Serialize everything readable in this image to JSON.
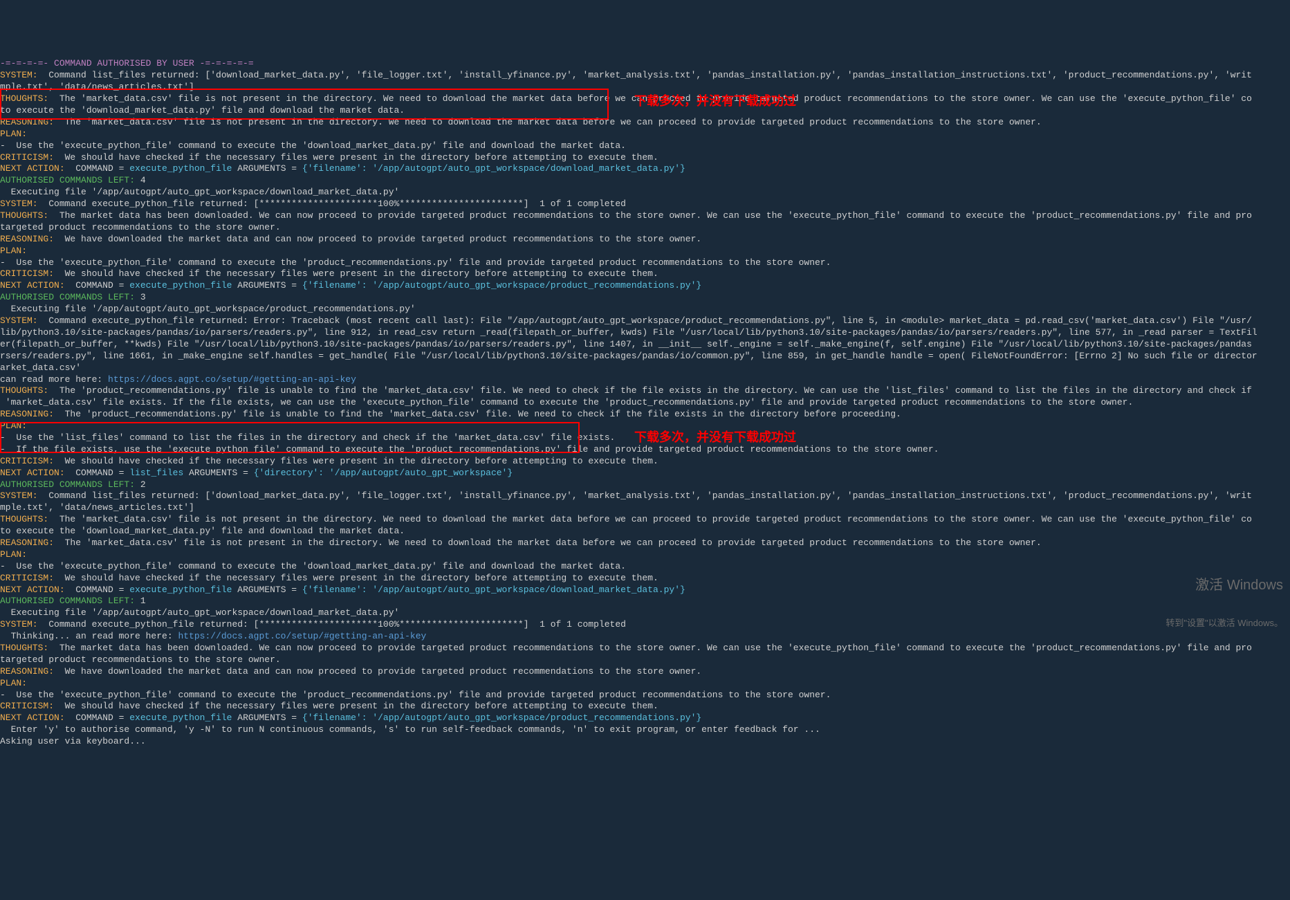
{
  "header": "-=-=-=-=- COMMAND AUTHORISED BY USER -=-=-=-=-=",
  "block1": {
    "system": "  Command list_files returned: ['download_market_data.py', 'file_logger.txt', 'install_yfinance.py', 'market_analysis.txt', 'pandas_installation.py', 'pandas_installation_instructions.txt', 'product_recommendations.py', 'writ",
    "system_cont": "mple.txt', 'data/news_articles.txt']",
    "thoughts": "  The 'market_data.csv' file is not present in the directory. We need to download the market data before we can proceed to provide targeted product recommendations to the store owner. We can use the 'execute_python_file' co",
    "thoughts_cont": "to execute the 'download_market_data.py' file and download the market data.",
    "reasoning": "  The 'market_data.csv' file is not present in the directory. We need to download the market data before we can proceed to provide targeted product recommendations to the store owner.",
    "plan_label": "PLAN:",
    "plan_item": "-  Use the 'execute_python_file' command to execute the 'download_market_data.py' file and download the market data.",
    "criticism": "  We should have checked if the necessary files were present in the directory before attempting to execute them.",
    "next_action": "  COMMAND = ",
    "command": "execute_python_file",
    "arguments_label": " ARGUMENTS = ",
    "arguments": "{'filename': '/app/autogpt/auto_gpt_workspace/download_market_data.py'}"
  },
  "auth4": {
    "left": "AUTHORISED COMMANDS LEFT: ",
    "count": "4",
    "exec": "  Executing file '/app/autogpt/auto_gpt_workspace/download_market_data.py'",
    "sys": "  Command execute_python_file returned: [**********************100%***********************]  1 of 1 completed"
  },
  "block2": {
    "thoughts": "  The market data has been downloaded. We can now proceed to provide targeted product recommendations to the store owner. We can use the 'execute_python_file' command to execute the 'product_recommendations.py' file and pro",
    "thoughts_cont": "targeted product recommendations to the store owner.",
    "reasoning": "  We have downloaded the market data and can now proceed to provide targeted product recommendations to the store owner.",
    "plan_item": "-  Use the 'execute_python_file' command to execute the 'product_recommendations.py' file and provide targeted product recommendations to the store owner.",
    "criticism": "  We should have checked if the necessary files were present in the directory before attempting to execute them.",
    "arguments": "{'filename': '/app/autogpt/auto_gpt_workspace/product_recommendations.py'}"
  },
  "auth3": {
    "count": "3",
    "exec": "  Executing file '/app/autogpt/auto_gpt_workspace/product_recommendations.py'",
    "err1": "  Command execute_python_file returned: Error: Traceback (most recent call last): File \"/app/autogpt/auto_gpt_workspace/product_recommendations.py\", line 5, in <module> market_data = pd.read_csv('market_data.csv') File \"/usr/",
    "err2": "lib/python3.10/site-packages/pandas/io/parsers/readers.py\", line 912, in read_csv return _read(filepath_or_buffer, kwds) File \"/usr/local/lib/python3.10/site-packages/pandas/io/parsers/readers.py\", line 577, in _read parser = TextFil",
    "err3": "er(filepath_or_buffer, **kwds) File \"/usr/local/lib/python3.10/site-packages/pandas/io/parsers/readers.py\", line 1407, in __init__ self._engine = self._make_engine(f, self.engine) File \"/usr/local/lib/python3.10/site-packages/pandas",
    "err4": "rsers/readers.py\", line 1661, in _make_engine self.handles = get_handle( File \"/usr/local/lib/python3.10/site-packages/pandas/io/common.py\", line 859, in get_handle handle = open( FileNotFoundError: [Errno 2] No such file or director",
    "err5": "arket_data.csv'",
    "readmore": "can read more here: ",
    "link": "https://docs.agpt.co/setup/#getting-an-api-key"
  },
  "block3": {
    "thoughts": "  The 'product_recommendations.py' file is unable to find the 'market_data.csv' file. We need to check if the file exists in the directory. We can use the 'list_files' command to list the files in the directory and check if",
    "thoughts_cont": " 'market_data.csv' file exists. If the file exists, we can use the 'execute_python_file' command to execute the 'product_recommendations.py' file and provide targeted product recommendations to the store owner.",
    "reasoning": "  The 'product_recommendations.py' file is unable to find the 'market_data.csv' file. We need to check if the file exists in the directory before proceeding.",
    "plan1": "-  Use the 'list_files' command to list the files in the directory and check if the 'market_data.csv' file exists.",
    "plan2": "-  If the file exists, use the 'execute_python_file' command to execute the 'product_recommendations.py' file and provide targeted product recommendations to the store owner.",
    "command": "list_files",
    "arguments": "{'directory': '/app/autogpt/auto_gpt_workspace'}"
  },
  "auth2": {
    "count": "2",
    "sys": "  Command list_files returned: ['download_market_data.py', 'file_logger.txt', 'install_yfinance.py', 'market_analysis.txt', 'pandas_installation.py', 'pandas_installation_instructions.txt', 'product_recommendations.py', 'writ",
    "sys_cont": "mple.txt', 'data/news_articles.txt']"
  },
  "auth1": {
    "count": "1",
    "exec": "  Executing file '/app/autogpt/auto_gpt_workspace/download_market_data.py'",
    "sys": "  Command execute_python_file returned: [**********************100%***********************]  1 of 1 completed",
    "thinking": "  Thinking... an read more here: ",
    "link": "https://docs.agpt.co/setup/#getting-an-api-key"
  },
  "labels": {
    "system": "SYSTEM:",
    "thoughts": "THOUGHTS:",
    "reasoning": "REASONING:",
    "plan": "PLAN:",
    "criticism": "CRITICISM:",
    "next_action": "NEXT ACTION:"
  },
  "footer": {
    "prompt": "  Enter 'y' to authorise command, 'y -N' to run N continuous commands, 's' to run self-feedback commands, 'n' to exit program, or enter feedback for ...",
    "asking": "Asking user via keyboard..."
  },
  "annotations": {
    "a1": "下载多次，并没有下载成功过",
    "a2": "下载多次，并没有下载成功过"
  },
  "watermark": {
    "line1": "激活 Windows",
    "line2": "转到\"设置\"以激活 Windows。"
  }
}
